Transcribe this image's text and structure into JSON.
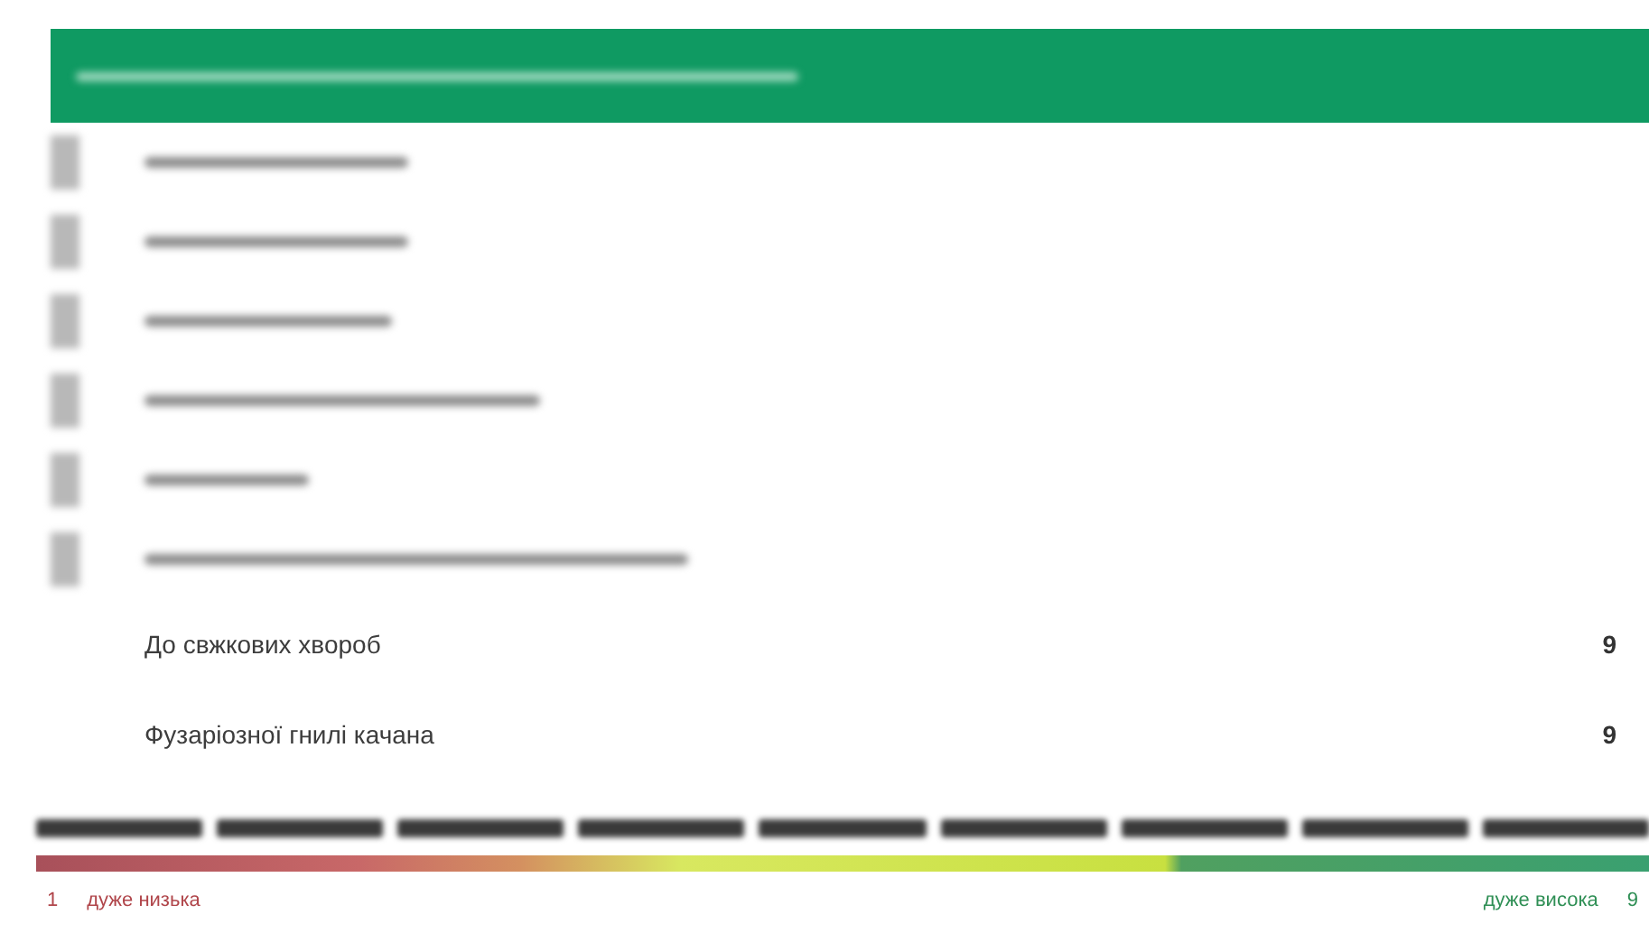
{
  "header": {
    "kind": "blurred"
  },
  "obscured_rows": [
    {
      "kind": "blurred"
    },
    {
      "kind": "blurred"
    },
    {
      "kind": "blurred"
    },
    {
      "kind": "blurred"
    },
    {
      "kind": "blurred"
    },
    {
      "kind": "blurred"
    }
  ],
  "traits": [
    {
      "name": "До свжкових хвороб",
      "score": "9"
    },
    {
      "name": "Фузаріозної гнилі качана",
      "score": "9"
    }
  ],
  "scale": {
    "steps": [
      {
        "kind": "blurred"
      },
      {
        "kind": "blurred"
      },
      {
        "kind": "blurred"
      },
      {
        "kind": "blurred"
      },
      {
        "kind": "blurred"
      },
      {
        "kind": "blurred"
      },
      {
        "kind": "blurred"
      },
      {
        "kind": "blurred"
      },
      {
        "kind": "blurred"
      }
    ],
    "low_number": "1",
    "low_label": "дуже низька",
    "high_label": "дуже висока",
    "high_number": "9"
  }
}
